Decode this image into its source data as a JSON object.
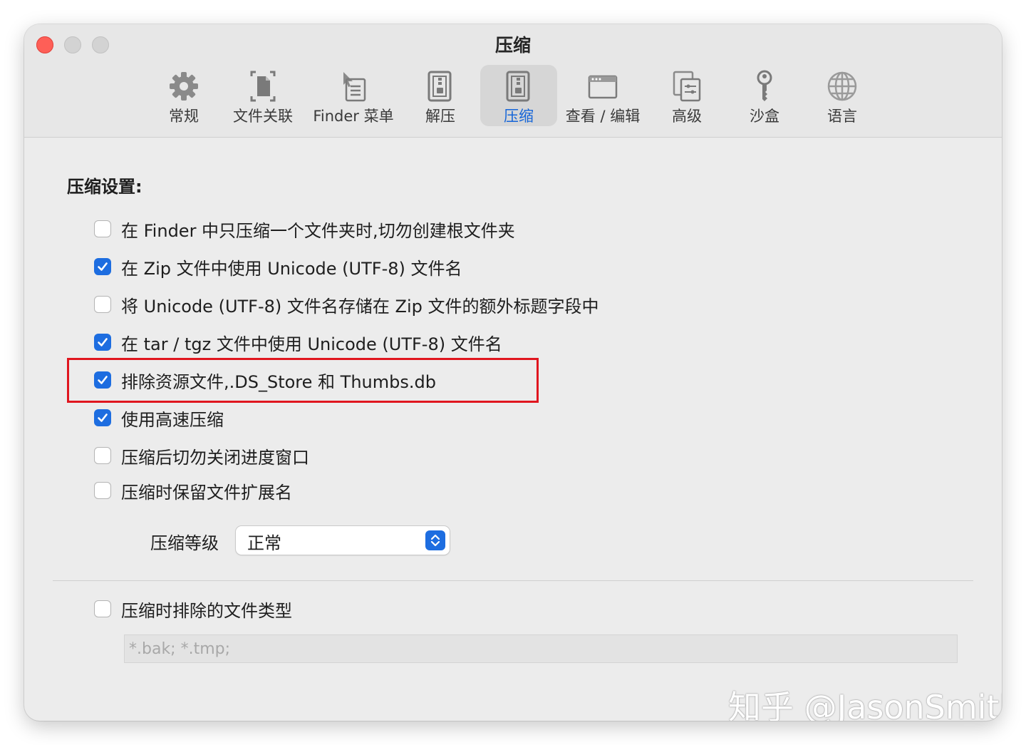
{
  "window": {
    "title": "压缩"
  },
  "toolbar": {
    "tabs": [
      {
        "label": "常规",
        "icon": "gear-icon",
        "active": false
      },
      {
        "label": "文件关联",
        "icon": "file-association-icon",
        "active": false
      },
      {
        "label": "Finder 菜单",
        "icon": "finder-menu-icon",
        "active": false
      },
      {
        "label": "解压",
        "icon": "extract-icon",
        "active": false
      },
      {
        "label": "压缩",
        "icon": "compress-icon",
        "active": true
      },
      {
        "label": "查看 / 编辑",
        "icon": "view-edit-icon",
        "active": false
      },
      {
        "label": "高级",
        "icon": "advanced-icon",
        "active": false
      },
      {
        "label": "沙盒",
        "icon": "sandbox-key-icon",
        "active": false
      },
      {
        "label": "语言",
        "icon": "globe-icon",
        "active": false
      }
    ]
  },
  "settings": {
    "title": "压缩设置:",
    "options": [
      {
        "label": "在 Finder 中只压缩一个文件夹时,切勿创建根文件夹",
        "checked": false
      },
      {
        "label": "在 Zip 文件中使用 Unicode (UTF-8) 文件名",
        "checked": true
      },
      {
        "label": "将 Unicode (UTF-8) 文件名存储在 Zip 文件的额外标题字段中",
        "checked": false
      },
      {
        "label": "在 tar / tgz 文件中使用 Unicode (UTF-8) 文件名",
        "checked": true
      },
      {
        "label": "排除资源文件,.DS_Store 和 Thumbs.db",
        "checked": true
      },
      {
        "label": "使用高速压缩",
        "checked": true
      },
      {
        "label": "压缩后切勿关闭进度窗口",
        "checked": false
      },
      {
        "label": "压缩时保留文件扩展名",
        "checked": false
      }
    ],
    "level": {
      "label": "压缩等级",
      "value": "正常"
    },
    "exclude_types": {
      "label": "压缩时排除的文件类型",
      "checked": false,
      "placeholder": "*.bak; *.tmp;"
    }
  },
  "watermark": "知乎 @JasonSmith",
  "colors": {
    "accent": "#1d6de0",
    "highlight": "#e0161f",
    "close": "#fe5f57"
  }
}
